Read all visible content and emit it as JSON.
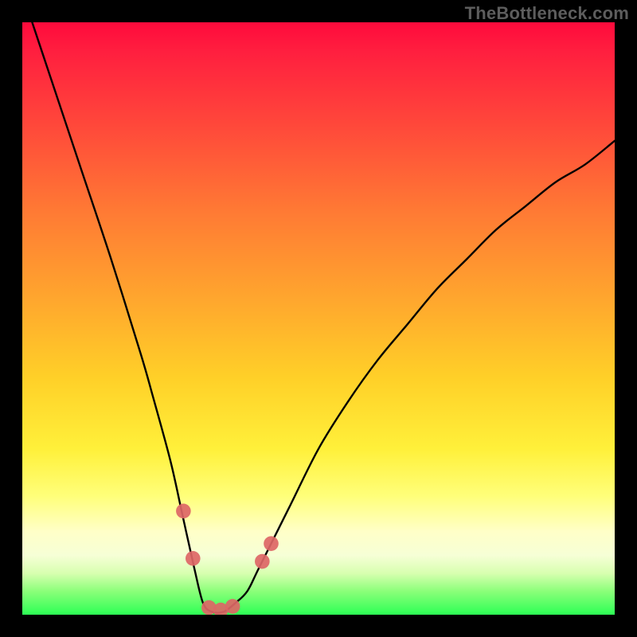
{
  "watermark": "TheBottleneck.com",
  "chart_data": {
    "type": "line",
    "title": "",
    "xlabel": "",
    "ylabel": "",
    "xlim": [
      0,
      100
    ],
    "ylim": [
      0,
      100
    ],
    "grid": false,
    "series": [
      {
        "name": "bottleneck-curve",
        "x": [
          0,
          5,
          10,
          15,
          20,
          22,
          25,
          27,
          29,
          30.5,
          32,
          34,
          36,
          38,
          40,
          45,
          50,
          55,
          60,
          65,
          70,
          75,
          80,
          85,
          90,
          95,
          100
        ],
        "values": [
          105,
          90,
          75,
          60,
          44,
          37,
          26,
          17,
          8,
          2,
          0.5,
          0.5,
          2,
          4,
          8,
          18,
          28,
          36,
          43,
          49,
          55,
          60,
          65,
          69,
          73,
          76,
          80
        ]
      }
    ],
    "markers": [
      {
        "name": "left-blob-upper",
        "x": 27.2,
        "y": 17.5
      },
      {
        "name": "left-blob-lower",
        "x": 28.8,
        "y": 9.5
      },
      {
        "name": "valley-left",
        "x": 31.5,
        "y": 1.2
      },
      {
        "name": "valley-mid",
        "x": 33.5,
        "y": 0.8
      },
      {
        "name": "valley-right",
        "x": 35.5,
        "y": 1.4
      },
      {
        "name": "right-blob-lower",
        "x": 40.5,
        "y": 9.0
      },
      {
        "name": "right-blob-upper",
        "x": 42.0,
        "y": 12.0
      }
    ],
    "marker_style": {
      "color": "#dd6666",
      "radius_pct": 1.25
    },
    "background_gradient": {
      "direction": "vertical",
      "stops": [
        {
          "pos": 0.0,
          "color": "#ff0a3c"
        },
        {
          "pos": 0.46,
          "color": "#ffa42e"
        },
        {
          "pos": 0.8,
          "color": "#ffff7a"
        },
        {
          "pos": 1.0,
          "color": "#2dff55"
        }
      ]
    }
  }
}
